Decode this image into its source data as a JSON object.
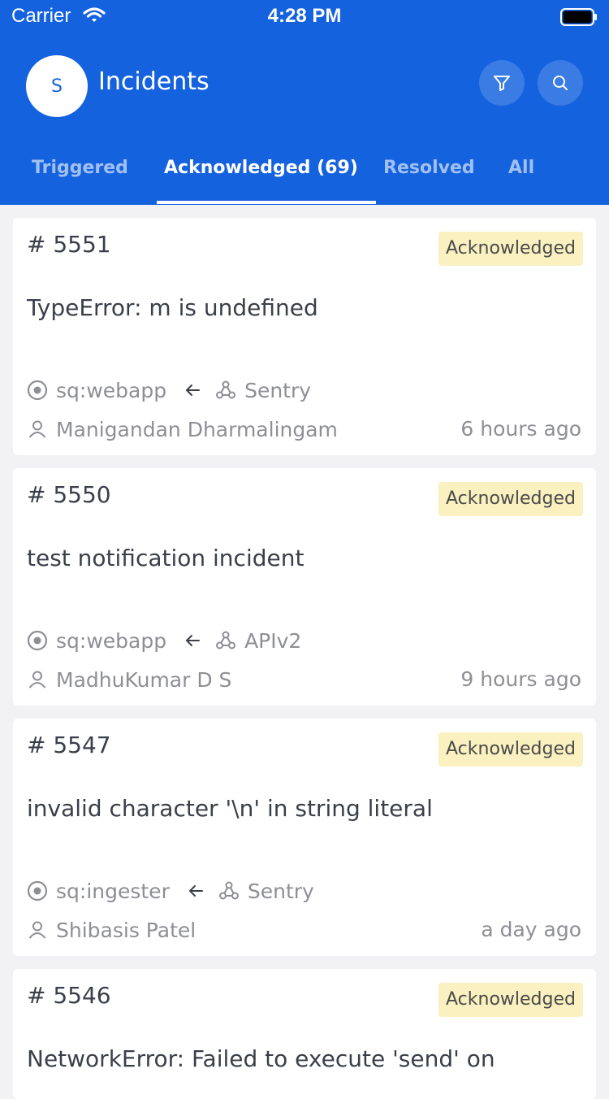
{
  "status_bar": {
    "carrier": "Carrier",
    "time": "4:28 PM"
  },
  "header": {
    "avatar_initial": "S",
    "title": "Incidents"
  },
  "tabs": [
    {
      "label": "Triggered",
      "active": false
    },
    {
      "label": "Acknowledged (69)",
      "active": true
    },
    {
      "label": "Resolved",
      "active": false
    },
    {
      "label": "All",
      "active": false
    }
  ],
  "incidents": [
    {
      "number": "# 5551",
      "status": "Acknowledged",
      "title": "TypeError: m is undefined",
      "service": "sq:webapp",
      "integration": "Sentry",
      "assignee": "Manigandan Dharmalingam",
      "time": "6 hours ago"
    },
    {
      "number": "# 5550",
      "status": "Acknowledged",
      "title": "test notification incident",
      "service": "sq:webapp",
      "integration": "APIv2",
      "assignee": "MadhuKumar D S",
      "time": "9 hours ago"
    },
    {
      "number": "# 5547",
      "status": "Acknowledged",
      "title": "invalid character '\\n' in string literal",
      "service": "sq:ingester",
      "integration": "Sentry",
      "assignee": "Shibasis Patel",
      "time": "a day ago"
    },
    {
      "number": "# 5546",
      "status": "Acknowledged",
      "title": "NetworkError: Failed to execute 'send' on",
      "service": "",
      "integration": "",
      "assignee": "",
      "time": ""
    }
  ],
  "colors": {
    "header_bg": "#1562df",
    "badge_bg": "#faf0c0",
    "page_bg": "#f2f2f4"
  }
}
